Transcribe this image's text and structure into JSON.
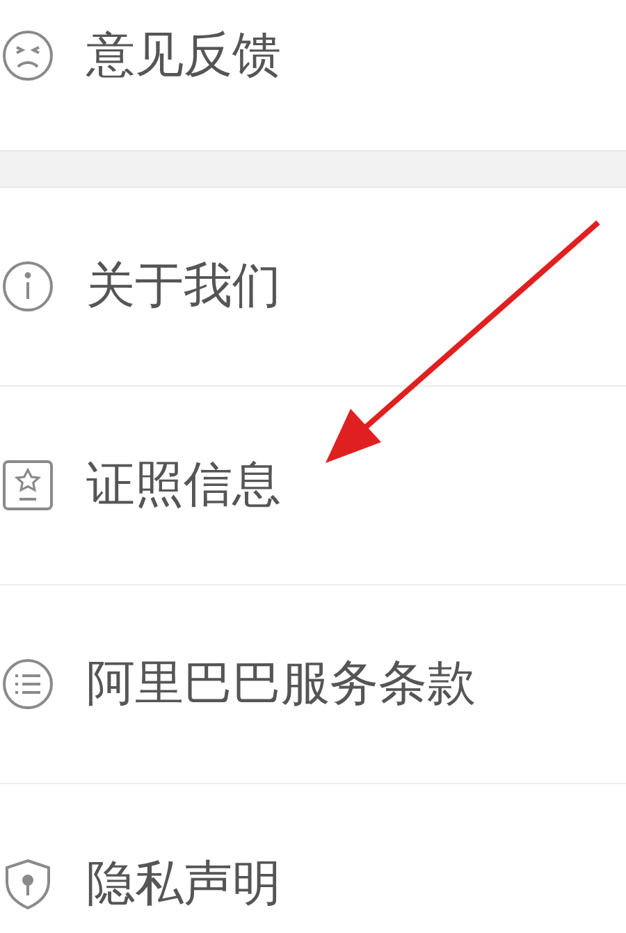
{
  "menu_groups": [
    {
      "items": [
        {
          "kind": "sad",
          "label": "意见反馈"
        }
      ]
    },
    {
      "items": [
        {
          "kind": "info",
          "label": "关于我们"
        },
        {
          "kind": "badge",
          "label": "证照信息"
        },
        {
          "kind": "list",
          "label": "阿里巴巴服务条款"
        },
        {
          "kind": "shield",
          "label": "隐私声明"
        }
      ]
    }
  ]
}
